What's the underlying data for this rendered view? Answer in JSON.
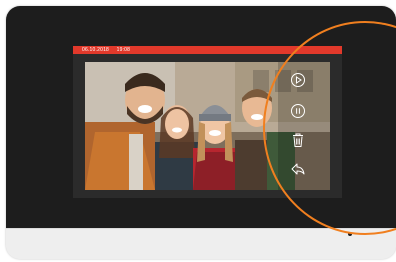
{
  "status_bar": {
    "date": "06.10.2018",
    "time": "19:08"
  },
  "controls": {
    "play_icon": "play-circle-icon",
    "pause_icon": "pause-circle-icon",
    "delete_icon": "trash-icon",
    "back_icon": "back-arrow-icon"
  },
  "colors": {
    "status_bar": "#e2392b",
    "highlight_ring": "#f07f1f",
    "bezel": "#1d1d1d"
  }
}
